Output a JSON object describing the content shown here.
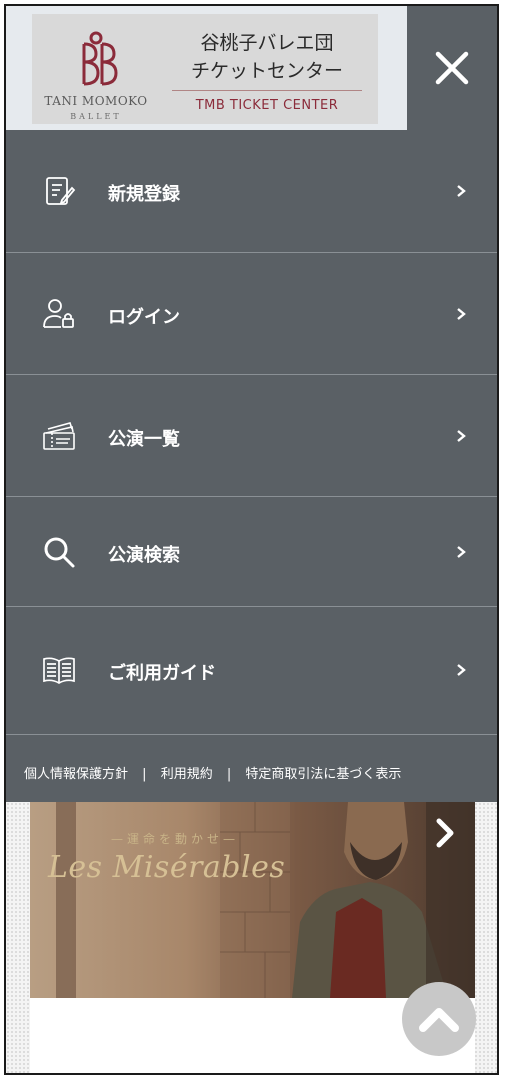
{
  "header": {
    "logo": {
      "brand_en": "TANI MOMOKO",
      "brand_sub": "BALLET",
      "title_line1": "谷桃子バレエ団",
      "title_line2": "チケットセンター",
      "title_en": "TMB TICKET CENTER",
      "accent_color": "#8b2b3a"
    },
    "close_icon": "close-icon"
  },
  "menu": {
    "items": [
      {
        "label": "新規登録",
        "icon": "register-form-icon"
      },
      {
        "label": "ログイン",
        "icon": "user-lock-icon"
      },
      {
        "label": "公演一覧",
        "icon": "tickets-icon"
      },
      {
        "label": "公演検索",
        "icon": "search-icon"
      },
      {
        "label": "ご利用ガイド",
        "icon": "book-icon"
      }
    ],
    "footer_links": [
      "個人情報保護方針",
      "利用規約",
      "特定商取引法に基づく表示"
    ],
    "footer_separator": "|",
    "background_color": "#5a6065"
  },
  "banner": {
    "tagline": "—運命を動かせ—",
    "title": "Les Misérables"
  }
}
